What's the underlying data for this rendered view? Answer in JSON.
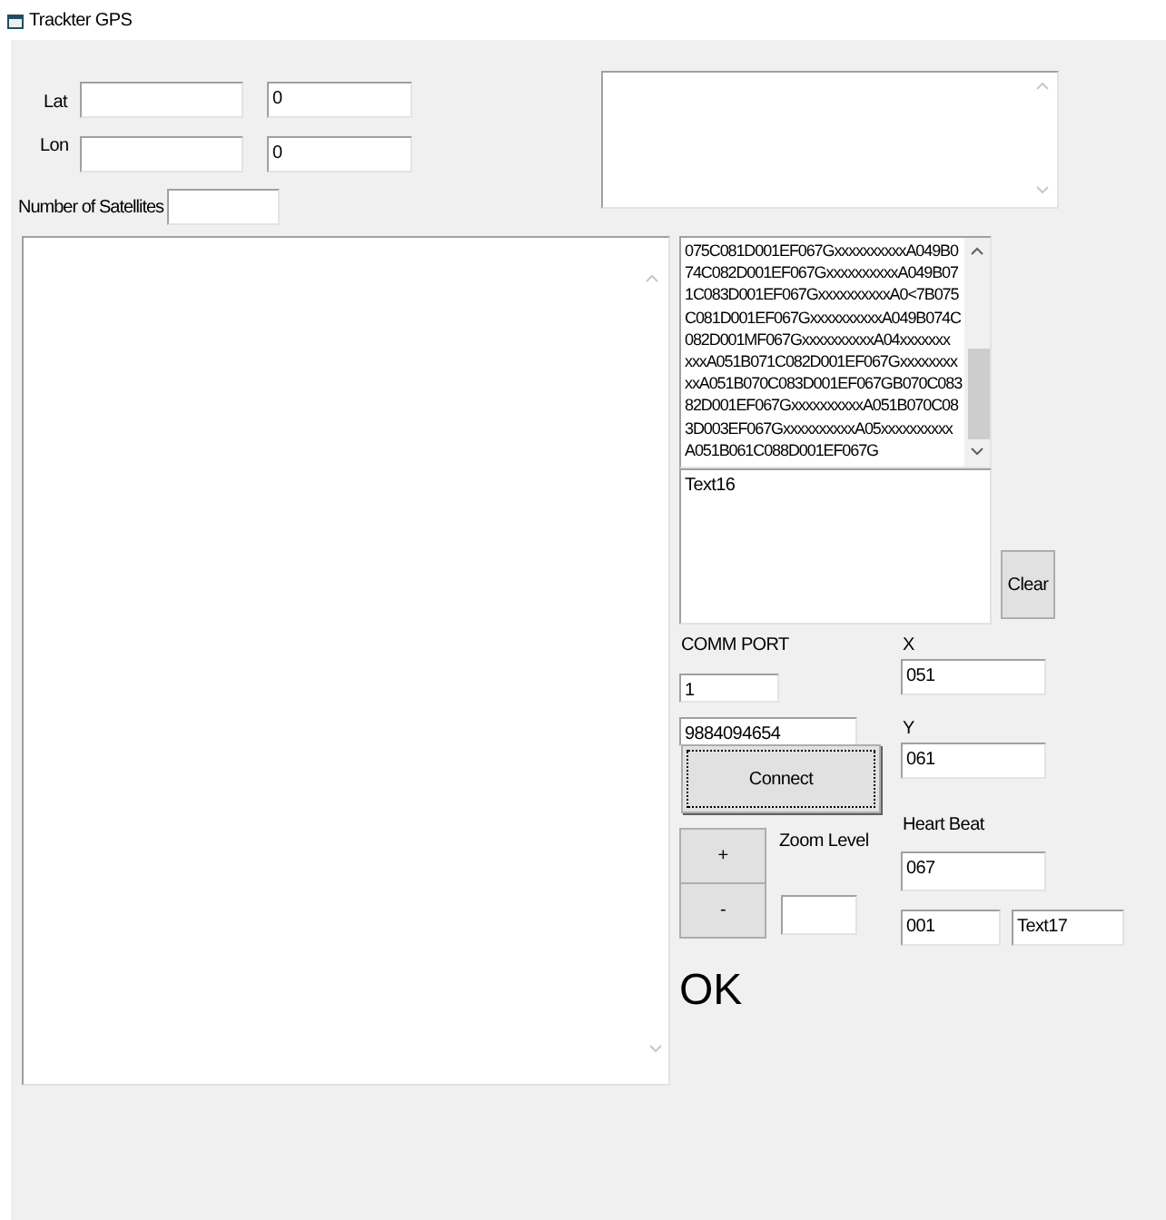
{
  "window": {
    "title": "Trackter GPS"
  },
  "lat": {
    "label": "Lat",
    "value_2": "0"
  },
  "lon": {
    "label": "Lon",
    "value_2": "0"
  },
  "satellites": {
    "label": "Number of Satellites"
  },
  "log_lines": [
    "075C081D001EF067GxxxxxxxxxxA049B0",
    "74C082D001EF067GxxxxxxxxxxA049B07",
    "1C083D001EF067GxxxxxxxxxxA0<7B075",
    "C081D001EF067GxxxxxxxxxxA049B074C",
    "082D001MF067GxxxxxxxxxxA04xxxxxxx",
    "xxxA051B071C082D001EF067Gxxxxxxxx",
    "xxA051B070C083D001EF067GB070C083",
    "82D001EF067GxxxxxxxxxxA051B070C08",
    "3D003EF067GxxxxxxxxxxA05xxxxxxxxxx",
    "A051B061C088D001EF067G"
  ],
  "text16": {
    "value": "Text16"
  },
  "clear_button": "Clear",
  "comm_port": {
    "label": "COMM PORT",
    "value": "1"
  },
  "phone": {
    "value": "9884094654"
  },
  "connect_button": "Connect",
  "x": {
    "label": "X",
    "value": "051"
  },
  "y": {
    "label": "Y",
    "value": "061"
  },
  "heart_beat": {
    "label": "Heart Beat",
    "value": "067"
  },
  "zoom": {
    "plus": "+",
    "minus": "-",
    "label": "Zoom Level"
  },
  "field_001": {
    "value": "001"
  },
  "text17": {
    "value": "Text17"
  },
  "status": "OK"
}
